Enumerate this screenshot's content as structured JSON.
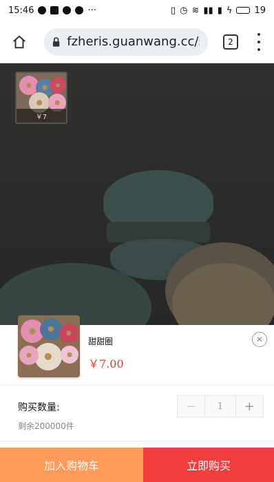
{
  "status_bar": {
    "time": "15:46",
    "more": "···",
    "battery_level": "19"
  },
  "browser": {
    "url": "fzheris.guanwang.cc/sl",
    "tab_count": "2"
  },
  "gallery": {
    "thumb_caption": "￥7"
  },
  "product": {
    "name": "甜甜圈",
    "price": "￥7.00"
  },
  "quantity": {
    "label": "购买数量:",
    "stock": "剩余200000件",
    "value": "1",
    "minus": "−",
    "plus": "+"
  },
  "actions": {
    "add_to_cart": "加入购物车",
    "buy_now": "立即购买"
  },
  "colors": {
    "add_to_cart": "#ff9a5a",
    "buy_now": "#f23d3d",
    "price": "#e53935"
  }
}
